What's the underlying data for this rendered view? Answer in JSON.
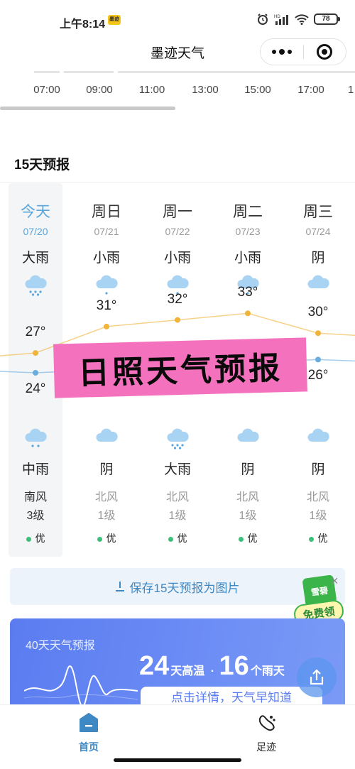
{
  "status_bar": {
    "time": "上午8:14",
    "app_badge": "墨迹",
    "battery": "78",
    "network": "HD 4G"
  },
  "nav": {
    "title": "墨迹天气"
  },
  "hourly": {
    "hours": [
      "07:00",
      "09:00",
      "11:00",
      "13:00",
      "15:00",
      "17:00",
      "1"
    ]
  },
  "forecast": {
    "title": "15天预报",
    "days": [
      {
        "name": "今天",
        "date": "07/20",
        "day_cond": "大雨",
        "day_icon": "heavy-rain-cloud-icon",
        "high": "27°",
        "low": "24°",
        "night_icon": "rain-cloud-icon",
        "night_cond": "中雨",
        "wind_dir": "南风",
        "wind_level": "3级",
        "aqi": "优"
      },
      {
        "name": "周日",
        "date": "07/21",
        "day_cond": "小雨",
        "day_icon": "light-rain-cloud-icon",
        "high": "31°",
        "low": "",
        "night_icon": "overcast-cloud-icon",
        "night_cond": "阴",
        "wind_dir": "北风",
        "wind_level": "1级",
        "aqi": "优"
      },
      {
        "name": "周一",
        "date": "07/22",
        "day_cond": "小雨",
        "day_icon": "light-rain-cloud-icon",
        "high": "32°",
        "low": "",
        "night_icon": "heavy-rain-cloud-icon",
        "night_cond": "大雨",
        "wind_dir": "北风",
        "wind_level": "1级",
        "aqi": "优"
      },
      {
        "name": "周二",
        "date": "07/23",
        "day_cond": "小雨",
        "day_icon": "light-rain-cloud-icon",
        "high": "33°",
        "low": "",
        "night_icon": "overcast-cloud-icon",
        "night_cond": "阴",
        "wind_dir": "北风",
        "wind_level": "1级",
        "aqi": "优"
      },
      {
        "name": "周三",
        "date": "07/24",
        "day_cond": "阴",
        "day_icon": "overcast-cloud-icon",
        "high": "30°",
        "low": "26°",
        "night_icon": "overcast-cloud-icon",
        "night_cond": "阴",
        "wind_dir": "北风",
        "wind_level": "1级",
        "aqi": "优"
      }
    ],
    "high_temps": [
      27,
      31,
      32,
      33,
      30
    ],
    "low_temps": [
      24,
      null,
      null,
      null,
      26
    ],
    "colors": {
      "high": "#f0b43a",
      "low": "#6aaedf",
      "aqi_good": "#3bbf7a",
      "today": "#5aa6dc"
    }
  },
  "sticker": {
    "text": "日照天气预报"
  },
  "save_bar": {
    "label": "保存15天预报为图片"
  },
  "ad": {
    "brand": "雪碧",
    "tag": "免费领",
    "close": "×"
  },
  "card40": {
    "title": "40天天气预报",
    "hot_days": "24",
    "hot_label": "天高温",
    "separator": "·",
    "rain_days": "16",
    "rain_label": "个雨天",
    "button": "点击详情，天气早知道"
  },
  "tabbar": {
    "home": "首页",
    "trace": "足迹"
  }
}
